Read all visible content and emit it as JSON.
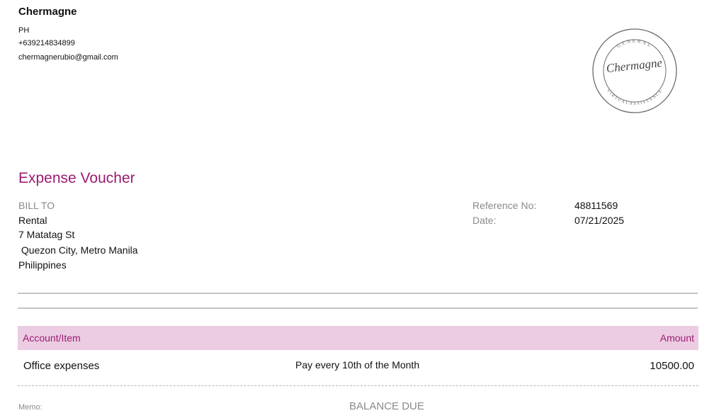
{
  "company": {
    "name": "Chermagne",
    "country": "PH",
    "phone": "+639214834899",
    "email": "chermagnerubio@gmail.com"
  },
  "logo": {
    "script_text": "Chermagne",
    "top_arc_text": "GENERAL",
    "bottom_arc_text": "VIRTUALASSISTANCE",
    "color": "#6b6b6b"
  },
  "document": {
    "title": "Expense Voucher",
    "accent_color": "#9c1b72",
    "header_fill": "#ebcce2"
  },
  "bill_to": {
    "label": "BILL TO",
    "name": "Rental",
    "address_line1": "7 Matatag St",
    "address_line2": " Quezon City, Metro Manila",
    "address_line3": "Philippines"
  },
  "meta": {
    "reference_label": "Reference No:",
    "reference_value": "48811569",
    "date_label": "Date:",
    "date_value": "07/21/2025"
  },
  "table": {
    "col_account": "Account/Item",
    "col_amount": "Amount",
    "rows": [
      {
        "item": "Office expenses",
        "description": "Pay every 10th of the Month",
        "amount": "10500.00"
      }
    ]
  },
  "footer": {
    "memo_label": "Memo:",
    "balance_label": "BALANCE DUE"
  }
}
